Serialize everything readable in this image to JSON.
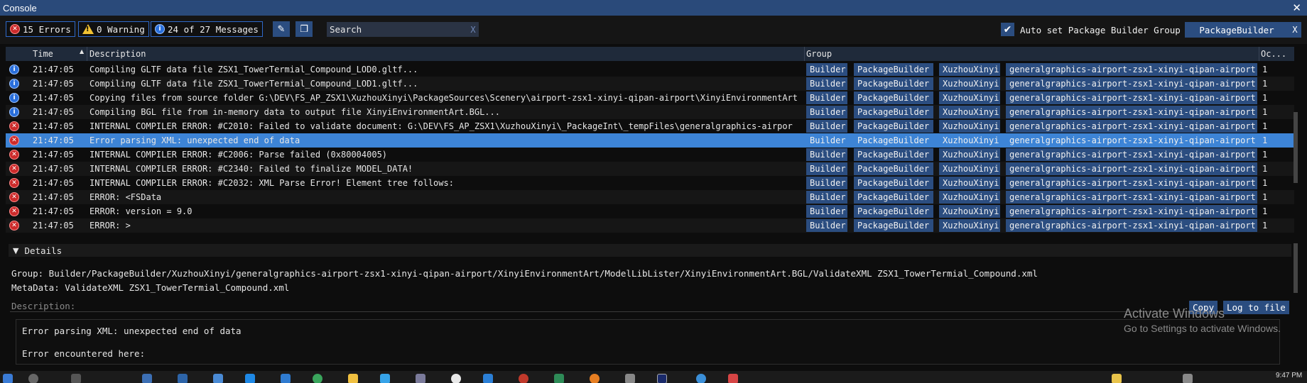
{
  "window": {
    "title": "Console"
  },
  "toolbar": {
    "errors_label": "15 Errors",
    "warnings_label": "0 Warning",
    "messages_label": "24 of 27 Messages",
    "search_placeholder": "Search",
    "search_clear": "X",
    "auto_set_label": "Auto set Package Builder Group",
    "auto_set_checked": true,
    "group_filter_value": "PackageBuilder",
    "group_filter_clear": "X"
  },
  "table": {
    "columns": {
      "time": "Time",
      "description": "Description",
      "group": "Group",
      "occurrences": "Oc..."
    },
    "rows": [
      {
        "level": "info",
        "time": "21:47:05",
        "description": "Compiling GLTF data file ZSX1_TowerTermial_Compound_LOD0.gltf...",
        "groups": [
          "Builder",
          "PackageBuilder",
          "XuzhouXinyi",
          "generalgraphics-airport-zsx1-xinyi-qipan-airport"
        ],
        "count": "1"
      },
      {
        "level": "info",
        "time": "21:47:05",
        "description": "Compiling GLTF data file ZSX1_TowerTermial_Compound_LOD1.gltf...",
        "groups": [
          "Builder",
          "PackageBuilder",
          "XuzhouXinyi",
          "generalgraphics-airport-zsx1-xinyi-qipan-airport"
        ],
        "count": "1"
      },
      {
        "level": "info",
        "time": "21:47:05",
        "description": "Copying files from source folder G:\\DEV\\FS_AP_ZSX1\\XuzhouXinyi\\PackageSources\\Scenery\\airport-zsx1-xinyi-qipan-airport\\XinyiEnvironmentArt",
        "groups": [
          "Builder",
          "PackageBuilder",
          "XuzhouXinyi",
          "generalgraphics-airport-zsx1-xinyi-qipan-airport"
        ],
        "count": "1"
      },
      {
        "level": "info",
        "time": "21:47:05",
        "description": "Compiling BGL file from in-memory data to output file XinyiEnvironmentArt.BGL...",
        "groups": [
          "Builder",
          "PackageBuilder",
          "XuzhouXinyi",
          "generalgraphics-airport-zsx1-xinyi-qipan-airport"
        ],
        "count": "1"
      },
      {
        "level": "error",
        "time": "21:47:05",
        "description": "INTERNAL COMPILER ERROR:  #C2010: Failed to validate document: G:\\DEV\\FS_AP_ZSX1\\XuzhouXinyi\\_PackageInt\\_tempFiles\\generalgraphics-airpor",
        "groups": [
          "Builder",
          "PackageBuilder",
          "XuzhouXinyi",
          "generalgraphics-airport-zsx1-xinyi-qipan-airport"
        ],
        "count": "1"
      },
      {
        "level": "error",
        "time": "21:47:05",
        "description": "Error parsing XML: unexpected end of data",
        "groups": [
          "Builder",
          "PackageBuilder",
          "XuzhouXinyi",
          "generalgraphics-airport-zsx1-xinyi-qipan-airport"
        ],
        "count": "1",
        "selected": true
      },
      {
        "level": "error",
        "time": "21:47:05",
        "description": "INTERNAL COMPILER ERROR:  #C2006: Parse failed  (0x80004005)",
        "groups": [
          "Builder",
          "PackageBuilder",
          "XuzhouXinyi",
          "generalgraphics-airport-zsx1-xinyi-qipan-airport"
        ],
        "count": "1"
      },
      {
        "level": "error",
        "time": "21:47:05",
        "description": "INTERNAL COMPILER ERROR:  #C2340: Failed to finalize MODEL_DATA!",
        "groups": [
          "Builder",
          "PackageBuilder",
          "XuzhouXinyi",
          "generalgraphics-airport-zsx1-xinyi-qipan-airport"
        ],
        "count": "1"
      },
      {
        "level": "error",
        "time": "21:47:05",
        "description": "INTERNAL COMPILER ERROR:  #C2032: XML Parse Error!  Element tree follows:",
        "groups": [
          "Builder",
          "PackageBuilder",
          "XuzhouXinyi",
          "generalgraphics-airport-zsx1-xinyi-qipan-airport"
        ],
        "count": "1"
      },
      {
        "level": "error",
        "time": "21:47:05",
        "description": "ERROR: <FSData",
        "groups": [
          "Builder",
          "PackageBuilder",
          "XuzhouXinyi",
          "generalgraphics-airport-zsx1-xinyi-qipan-airport"
        ],
        "count": "1"
      },
      {
        "level": "error",
        "time": "21:47:05",
        "description": "ERROR:     version = 9.0",
        "groups": [
          "Builder",
          "PackageBuilder",
          "XuzhouXinyi",
          "generalgraphics-airport-zsx1-xinyi-qipan-airport"
        ],
        "count": "1"
      },
      {
        "level": "error",
        "time": "21:47:05",
        "description": "ERROR: >",
        "groups": [
          "Builder",
          "PackageBuilder",
          "XuzhouXinyi",
          "generalgraphics-airport-zsx1-xinyi-qipan-airport"
        ],
        "count": "1"
      }
    ]
  },
  "details": {
    "header": "Details",
    "group_line": "Group: Builder/PackageBuilder/XuzhouXinyi/generalgraphics-airport-zsx1-xinyi-qipan-airport/XinyiEnvironmentArt/ModelLibLister/XinyiEnvironmentArt.BGL/ValidateXML ZSX1_TowerTermial_Compound.xml",
    "metadata_line": "MetaData: ValidateXML ZSX1_TowerTermial_Compound.xml",
    "description_label": "Description:",
    "copy_label": "Copy",
    "log_label": "Log to file",
    "description_line1": "Error parsing XML: unexpected end of data",
    "description_line2": "Error encountered here:"
  },
  "watermark": {
    "line1": "Activate Windows",
    "line2": "Go to Settings to activate Windows."
  },
  "taskbar": {
    "time": "9:47 PM"
  },
  "colors": {
    "accent": "#2b4d80",
    "selected": "#3d84d6",
    "error": "#cc2b2b",
    "info": "#2a6fdb",
    "warning": "#f1c232"
  }
}
